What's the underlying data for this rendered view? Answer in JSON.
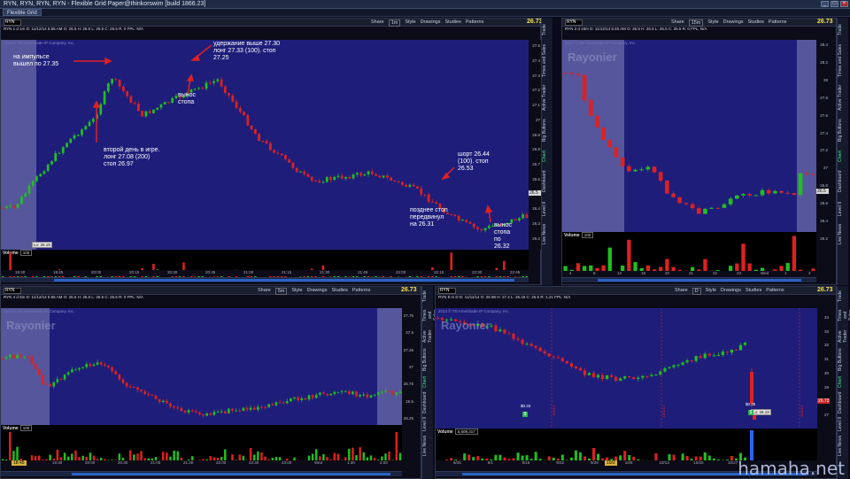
{
  "window": {
    "title": "RYN, RYN, RYN, RYN - Flexible Grid Paper@thinkorswim [build 1866.23]",
    "grid_tab": "Flexible Grid"
  },
  "toolbar": {
    "share": "Share",
    "style": "Style",
    "drawings": "Drawings",
    "studies": "Studies",
    "patterns": "Patterns"
  },
  "panels": [
    {
      "id": "p1",
      "symbol": "RYN",
      "tf": "1m",
      "price": "26.73",
      "info": "RYN 1 d 1m  D: 11/12/14 5:55 AM  O: 26.5  H: 26.5  L: 26.5  C: 26.5  R: 0  FPL: N/A",
      "company": "2014 © TD Ameritrade IP Company, Inc.",
      "yticks": [
        "27.5",
        "27.4",
        "27.3",
        "27.2",
        "27.1",
        "27",
        "26.9",
        "26.8",
        "26.7",
        "26.6",
        "26.5",
        "26.4",
        "26.3",
        "26.2"
      ],
      "price_label": "26.5",
      "lo": "Lo: 26.19",
      "vol_label": "Volume",
      "vol_value": "100",
      "vol_ticks": [
        "300",
        "200",
        "100"
      ],
      "xticks": [
        "19:30",
        "19:45",
        "20:00",
        "20:15",
        "20:30",
        "20:45",
        "21:00",
        "21:15",
        "21:30",
        "21:45",
        "22:00",
        "22:15",
        "22:30",
        "22:45"
      ]
    },
    {
      "id": "p2",
      "symbol": "RYN",
      "tf": "15m",
      "price": "26.73",
      "info": "RYN 3 d 15m  D: 11/12/14 5:45 AM  O: 26.5  H: 26.5  L: 26.5  C: 26.5  R: 0  FPL: N/A",
      "company": "2014 © TD Ameritrade IP Company, Inc.",
      "wm": "Rayonier",
      "yticks": [
        "28.4",
        "28.2",
        "28",
        "27.8",
        "27.6",
        "27.4",
        "27.2",
        "27",
        "26.8",
        "26.6",
        "26.4",
        "26.2"
      ],
      "price_label": "26.5",
      "lo": "Lo: 26.19",
      "vol_label": "Volume",
      "vol_value": "100",
      "vol_ticks": [
        "500K",
        "400K",
        "300K",
        "200K",
        "100K"
      ],
      "xticks": [
        "4",
        "8",
        "12",
        "16",
        "20",
        "21",
        "22",
        "23",
        "Wed",
        "1",
        "2"
      ]
    },
    {
      "id": "p3",
      "symbol": "RYN",
      "tf": "5m",
      "price": "26.73",
      "info": "RYN 4 d 5m  D: 11/12/14 5:55 AM  O: 26.5  H: 26.5  L: 26.5  C: 26.5  R: 0  FPL: N/A",
      "company": "2014 © TD Ameritrade IP Company, Inc.",
      "wm": "Rayonier",
      "yticks": [
        "27.75",
        "27.5",
        "27.25",
        "27",
        "26.75",
        "26.5",
        "26.25"
      ],
      "lo": "Lo: 26.19",
      "vol_label": "Volume",
      "vol_value": "100",
      "vol_ticks": [
        "300",
        "200",
        "100"
      ],
      "xticks": [
        "19:30",
        "20:00",
        "20:30",
        "21:00",
        "21:30",
        "22:00",
        "22:30",
        "23:00",
        "Wed",
        "1:30",
        "2:00"
      ],
      "time_badge": "18:45"
    },
    {
      "id": "p4",
      "symbol": "RYN",
      "tf": "D",
      "price": "26.73",
      "info": "RYN 8 m D  D: 11/11/14  O: 26.96  H: 27.4  L: 26.19  C: 26.5  R: 1.21  FPL: N/A",
      "company": "2014 © TD Ameritrade IP Company, Inc.",
      "wm": "Rayonier",
      "yticks": [
        "34",
        "33",
        "32",
        "31",
        "30",
        "29",
        "28",
        "27"
      ],
      "price_label": "26.73",
      "lo": "Lo: 26.19",
      "vol_label": "Volume",
      "vol_value": "5,609,317",
      "vol_ticks": [
        "5M",
        "4M",
        "3M",
        "2M",
        "1M"
      ],
      "xticks": [
        "6/25",
        "9/1",
        "9/15",
        "9/22",
        "9/29",
        "10/6",
        "10/13",
        "10/20",
        "10/27"
      ],
      "div_labels": [
        "$0.33",
        "$0.35"
      ],
      "month_labels": [
        "9/1/14",
        "10/1/14",
        "11/1/14"
      ],
      "time_badge": "10/2"
    }
  ],
  "side_tabs": [
    "Trade",
    "Times and Sales",
    "Active Trader",
    "Big Buttons",
    "Chart",
    "Dashboard",
    "Level II",
    "Live News"
  ],
  "annotations": {
    "a1": "на импульсе\nвышел по 27.35",
    "a2": "удержание выше 27.30\nлонг 27.33 (100). стоп\n27.25",
    "a3": "вынос\nстопа",
    "a4": "второй день в игре.\nлонг 27.08 (200)\nстоп 26.97",
    "a5": "шорт 26.44\n(100). стоп\n26.53",
    "a6": "позднее стоп\nпередвинул\nна 26.31",
    "a7": "вынос\nстопа\nпо\n26.32"
  },
  "watermark_site": "hamaha.net",
  "colors": {
    "bull": "#1fc01f",
    "bear": "#e02020",
    "plot_bg": "#1e1e7a",
    "ext_hours": "#6a6aa8"
  }
}
